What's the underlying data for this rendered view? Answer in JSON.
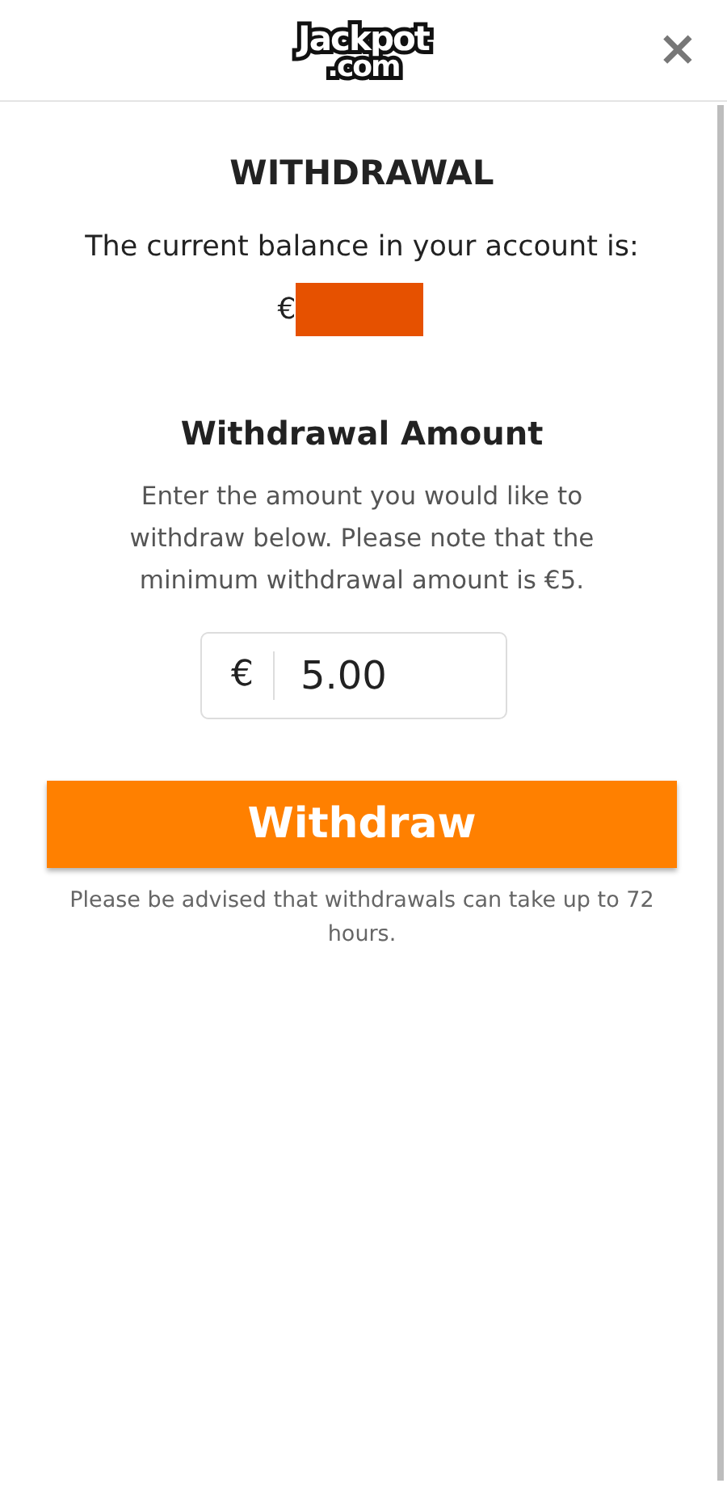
{
  "header": {
    "logo_top": "Jackpot",
    "logo_bottom": ".com",
    "close": "×"
  },
  "title": "WITHDRAWAL",
  "balance": {
    "label": "The current balance in your account is:",
    "currency": "€",
    "redacted": true
  },
  "amount_section": {
    "heading": "Withdrawal Amount",
    "description": "Enter the amount you would like to withdraw below. Please note that the minimum withdrawal amount is €5.",
    "currency": "€",
    "value": "5.00"
  },
  "button": "Withdraw",
  "note": "Please be advised that withdrawals can take up to 72 hours."
}
